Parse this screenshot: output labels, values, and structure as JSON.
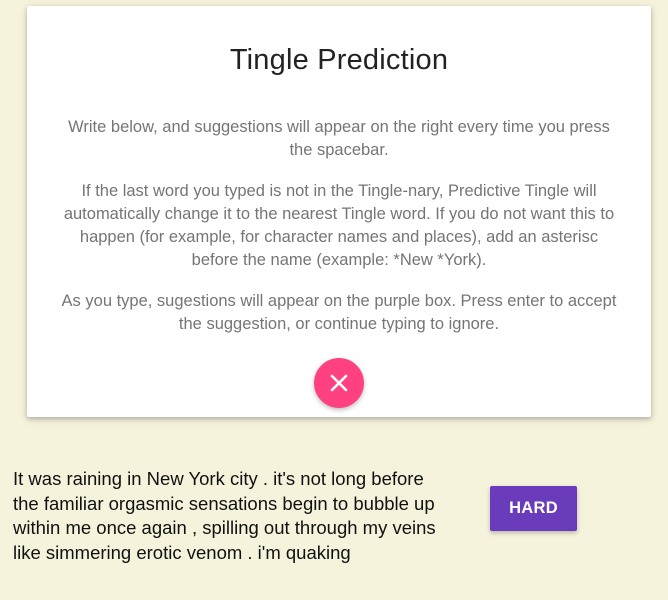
{
  "dialog": {
    "title": "Tingle Prediction",
    "paragraphs": [
      "Write below, and suggestions will appear on the right every time you press the spacebar.",
      "If the last word you typed is not in the Tingle-nary, Predictive Tingle will automatically change it to the nearest Tingle word. If you do not want this to happen (for example, for character names and places), add an asterisc before the name (example: *New *York).",
      "As you type, sugestions will appear on the purple box. Press enter to accept the suggestion, or continue typing to ignore."
    ],
    "close_icon": "close-icon",
    "close_color": "#ff4081"
  },
  "editor": {
    "text": "It was raining in New York city . it's not long before the familiar orgasmic sensations begin to bubble up within me once again , spilling out through my veins like simmering erotic venom . i'm quaking"
  },
  "suggestion": {
    "label": "HARD",
    "color": "#6a3cbc"
  },
  "colors": {
    "background": "#f5f3dc",
    "card": "#ffffff"
  }
}
